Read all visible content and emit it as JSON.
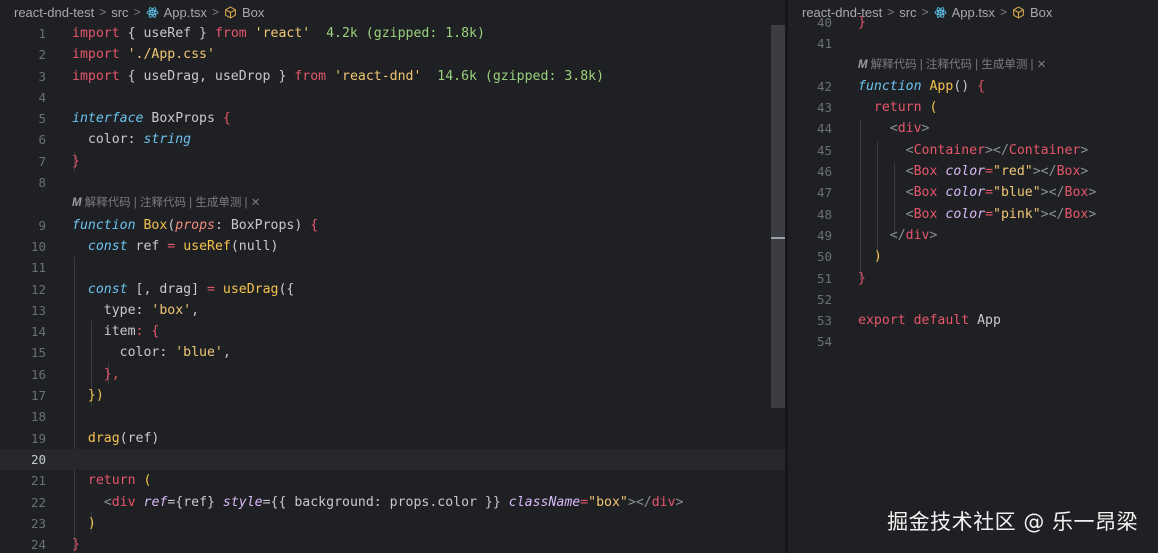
{
  "left": {
    "breadcrumb": {
      "project": "react-dnd-test",
      "folder": "src",
      "file": "App.tsx",
      "symbol": "Box"
    },
    "codelens": "解释代码 | 注释代码 | 生成单测 | ✕",
    "lines": {
      "l1": {
        "n": "1",
        "a": "import",
        "b": " { ",
        "c": "useRef",
        "d": " } ",
        "e": "from",
        "f": " ",
        "g": "'react'",
        "h": "  4.2k (gzipped: 1.8k)"
      },
      "l2": {
        "n": "2",
        "a": "import",
        "b": " ",
        "g": "'./App.css'"
      },
      "l3": {
        "n": "3",
        "a": "import",
        "b": " { ",
        "c": "useDrag, useDrop",
        "d": " } ",
        "e": "from",
        "f": " ",
        "g": "'react-dnd'",
        "h": "  14.6k (gzipped: 3.8k)"
      },
      "l4": {
        "n": "4"
      },
      "l5": {
        "n": "5",
        "a": "interface",
        "b": " BoxProps ",
        "c": "{"
      },
      "l6": {
        "n": "6",
        "a": "color",
        "b": ": ",
        "c": "string"
      },
      "l7": {
        "n": "7",
        "a": "}"
      },
      "l8": {
        "n": "8"
      },
      "l9": {
        "n": "9",
        "a": "function",
        "b": " ",
        "c": "Box",
        "d": "(",
        "e": "props",
        "f": ": BoxProps) ",
        "g": "{"
      },
      "l10": {
        "n": "10",
        "a": "const",
        "b": " ref ",
        "c": "=",
        "d": " ",
        "e": "useRef",
        "f": "(null)"
      },
      "l11": {
        "n": "11"
      },
      "l12": {
        "n": "12",
        "a": "const",
        "b": " [, drag] ",
        "c": "=",
        "d": " ",
        "e": "useDrag",
        "f": "({"
      },
      "l13": {
        "n": "13",
        "a": "type",
        "b": ": ",
        "c": "'box'",
        "d": ","
      },
      "l14": {
        "n": "14",
        "a": "item",
        "b": ": {"
      },
      "l15": {
        "n": "15",
        "a": "color",
        "b": ": ",
        "c": "'blue'",
        "d": ","
      },
      "l16": {
        "n": "16",
        "a": "},"
      },
      "l17": {
        "n": "17",
        "a": "})"
      },
      "l18": {
        "n": "18"
      },
      "l19": {
        "n": "19",
        "a": "drag",
        "b": "(ref)"
      },
      "l20": {
        "n": "20"
      },
      "l21": {
        "n": "21",
        "a": "return",
        "b": " ("
      },
      "l22": {
        "n": "22",
        "a": "<",
        "b": "div",
        "c": " ",
        "d": "ref",
        "e": "={ref} ",
        "f": "style",
        "g": "={{ background: props.color }} ",
        "h": "className",
        "i": "=",
        "j": "\"box\"",
        "k": "></",
        "l": "div",
        "m": ">"
      },
      "l23": {
        "n": "23",
        "a": ")"
      },
      "l24": {
        "n": "24",
        "a": "}"
      }
    }
  },
  "right": {
    "breadcrumb": {
      "project": "react-dnd-test",
      "folder": "src",
      "file": "App.tsx",
      "symbol": "Box"
    },
    "codelens": "解释代码 | 注释代码 | 生成单测 | ✕",
    "lines": {
      "l40": {
        "n": "40",
        "a": "}"
      },
      "l41": {
        "n": "41"
      },
      "l42": {
        "n": "42",
        "a": "function",
        "b": " ",
        "c": "App",
        "d": "() ",
        "e": "{"
      },
      "l43": {
        "n": "43",
        "a": "return",
        "b": " ("
      },
      "l44": {
        "n": "44",
        "a": "<",
        "b": "div",
        "c": ">"
      },
      "l45": {
        "n": "45",
        "a": "<",
        "b": "Container",
        "c": "></",
        "d": "Container",
        "e": ">"
      },
      "l46": {
        "n": "46",
        "a": "<",
        "b": "Box",
        "c": " ",
        "d": "color",
        "e": "=",
        "f": "\"red\"",
        "g": "></",
        "h": "Box",
        "i": ">"
      },
      "l47": {
        "n": "47",
        "a": "<",
        "b": "Box",
        "c": " ",
        "d": "color",
        "e": "=",
        "f": "\"blue\"",
        "g": "></",
        "h": "Box",
        "i": ">"
      },
      "l48": {
        "n": "48",
        "a": "<",
        "b": "Box",
        "c": " ",
        "d": "color",
        "e": "=",
        "f": "\"pink\"",
        "g": "></",
        "h": "Box",
        "i": ">"
      },
      "l49": {
        "n": "49",
        "a": "</",
        "b": "div",
        "c": ">"
      },
      "l50": {
        "n": "50",
        "a": ")"
      },
      "l51": {
        "n": "51",
        "a": "}"
      },
      "l52": {
        "n": "52"
      },
      "l53": {
        "n": "53",
        "a": "export",
        "b": " ",
        "c": "default",
        "d": " App"
      },
      "l54": {
        "n": "54"
      }
    }
  },
  "watermark": "掘金技术社区 @ 乐一昂梁",
  "colors": {
    "background": "#1f2023",
    "keyword": "#e5566a",
    "string": "#f0c674",
    "function": "#f4c24d",
    "type_hint": "#9bd17b"
  }
}
